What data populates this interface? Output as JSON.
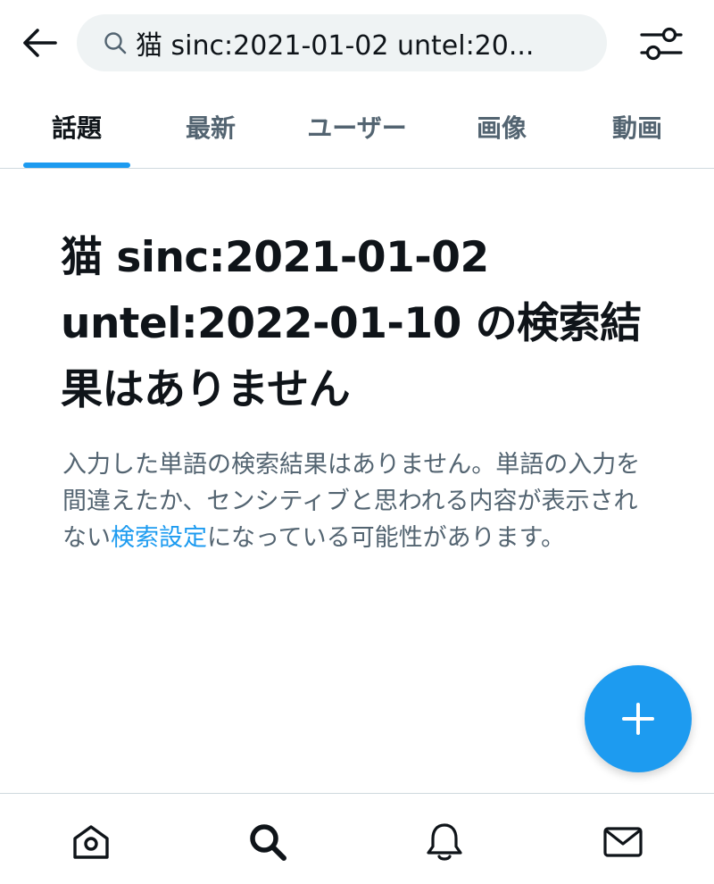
{
  "search": {
    "query": "猫 sinc:2021-01-02 untel:20..."
  },
  "tabs": [
    {
      "label": "話題",
      "active": true
    },
    {
      "label": "最新",
      "active": false
    },
    {
      "label": "ユーザー",
      "active": false
    },
    {
      "label": "画像",
      "active": false
    },
    {
      "label": "動画",
      "active": false
    }
  ],
  "empty_state": {
    "heading": "猫 sinc:2021-01-02 untel:2022-01-10 の検索結果はありません",
    "description_before": "入力した単語の検索結果はありません。単語の入力を間違えたか、センシティブと思われる内容が表示されない",
    "description_link": "検索設定",
    "description_after": "になっている可能性があります。"
  },
  "bottom_nav": {
    "items": [
      "home-icon",
      "search-icon",
      "bell-icon",
      "mail-icon"
    ]
  },
  "colors": {
    "accent": "#1d9bf0",
    "text_primary": "#0f1419",
    "text_secondary": "#536471",
    "search_bg": "#eff3f4",
    "divider": "#cfd9de"
  }
}
